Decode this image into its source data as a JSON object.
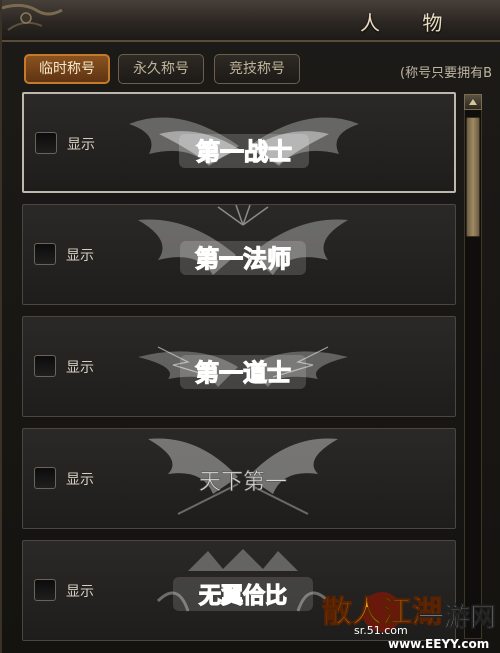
{
  "window": {
    "title": "人 物"
  },
  "tabs": [
    {
      "label": "临时称号",
      "active": true
    },
    {
      "label": "永久称号",
      "active": false
    },
    {
      "label": "竞技称号",
      "active": false
    }
  ],
  "hint": "(称号只要拥有B",
  "titles": [
    {
      "show_label": "显示",
      "checked": false,
      "title": "第一战士",
      "selected": true
    },
    {
      "show_label": "显示",
      "checked": false,
      "title": "第一法师",
      "selected": false
    },
    {
      "show_label": "显示",
      "checked": false,
      "title": "第一道士",
      "selected": false
    },
    {
      "show_label": "显示",
      "checked": false,
      "title": "天下第一",
      "selected": false
    },
    {
      "show_label": "显示",
      "checked": false,
      "title": "无翼佮比",
      "selected": false
    }
  ],
  "watermark": {
    "logo": "散人江湖",
    "site": "sr.51.com",
    "brand": "一游网",
    "url": "www.EEYY.com"
  },
  "colors": {
    "accent_tab": "#c47a2a",
    "panel": "#1e1d1b",
    "badge_glow": "#ffffff"
  }
}
